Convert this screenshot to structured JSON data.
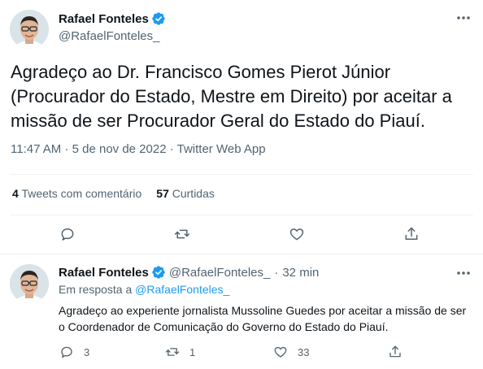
{
  "main_tweet": {
    "author_name": "Rafael Fonteles",
    "author_handle": "@RafaelFonteles_",
    "text": "Agradeço ao Dr. Francisco Gomes Pierot Júnior (Procurador do Estado, Mestre em Direito) por aceitar a missão de ser Procurador Geral do Estado do Piauí.",
    "time": "11:47 AM",
    "separator": "·",
    "date": "5 de nov de 2022",
    "source": "Twitter Web App",
    "stats": {
      "quote_count": "4",
      "quote_label": "Tweets com comentário",
      "like_count": "57",
      "like_label": "Curtidas"
    },
    "more_icon": "ellipsis-icon"
  },
  "reply_tweet": {
    "author_name": "Rafael Fonteles",
    "author_handle": "@RafaelFonteles_",
    "separator": "·",
    "time_ago": "32 min",
    "reply_prefix": "Em resposta a",
    "reply_target": "@RafaelFonteles_",
    "text": "Agradeço ao experiente jornalista Mussoline Guedes por aceitar a missão de ser o Coordenador de Comunicação do Governo do Estado do Piauí.",
    "reply_count": "3",
    "retweet_count": "1",
    "like_count": "33"
  },
  "colors": {
    "verified": "#1d9bf0",
    "link": "#1d9bf0",
    "secondary_text": "#536471",
    "divider": "#eff3f4"
  }
}
